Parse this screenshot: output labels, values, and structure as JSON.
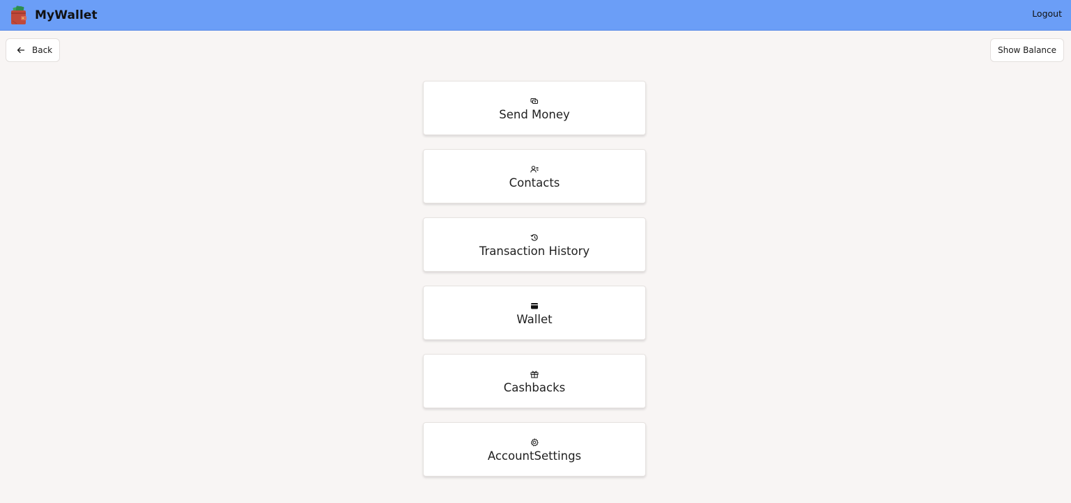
{
  "app": {
    "name": "MyWallet",
    "logo_icon": "wallet-logo-icon"
  },
  "header": {
    "logout_label": "Logout",
    "background_color": "#6b9ef7"
  },
  "toolbar": {
    "back_label": "Back",
    "back_icon": "arrow-left-icon",
    "show_balance_label": "Show Balance"
  },
  "menu": {
    "items": [
      {
        "label": "Send Money",
        "icon": "send-money-icon"
      },
      {
        "label": "Contacts",
        "icon": "contacts-icon"
      },
      {
        "label": "Transaction History",
        "icon": "history-icon"
      },
      {
        "label": "Wallet",
        "icon": "wallet-icon"
      },
      {
        "label": "Cashbacks",
        "icon": "gift-icon"
      },
      {
        "label": "AccountSettings",
        "icon": "gear-icon"
      }
    ]
  }
}
